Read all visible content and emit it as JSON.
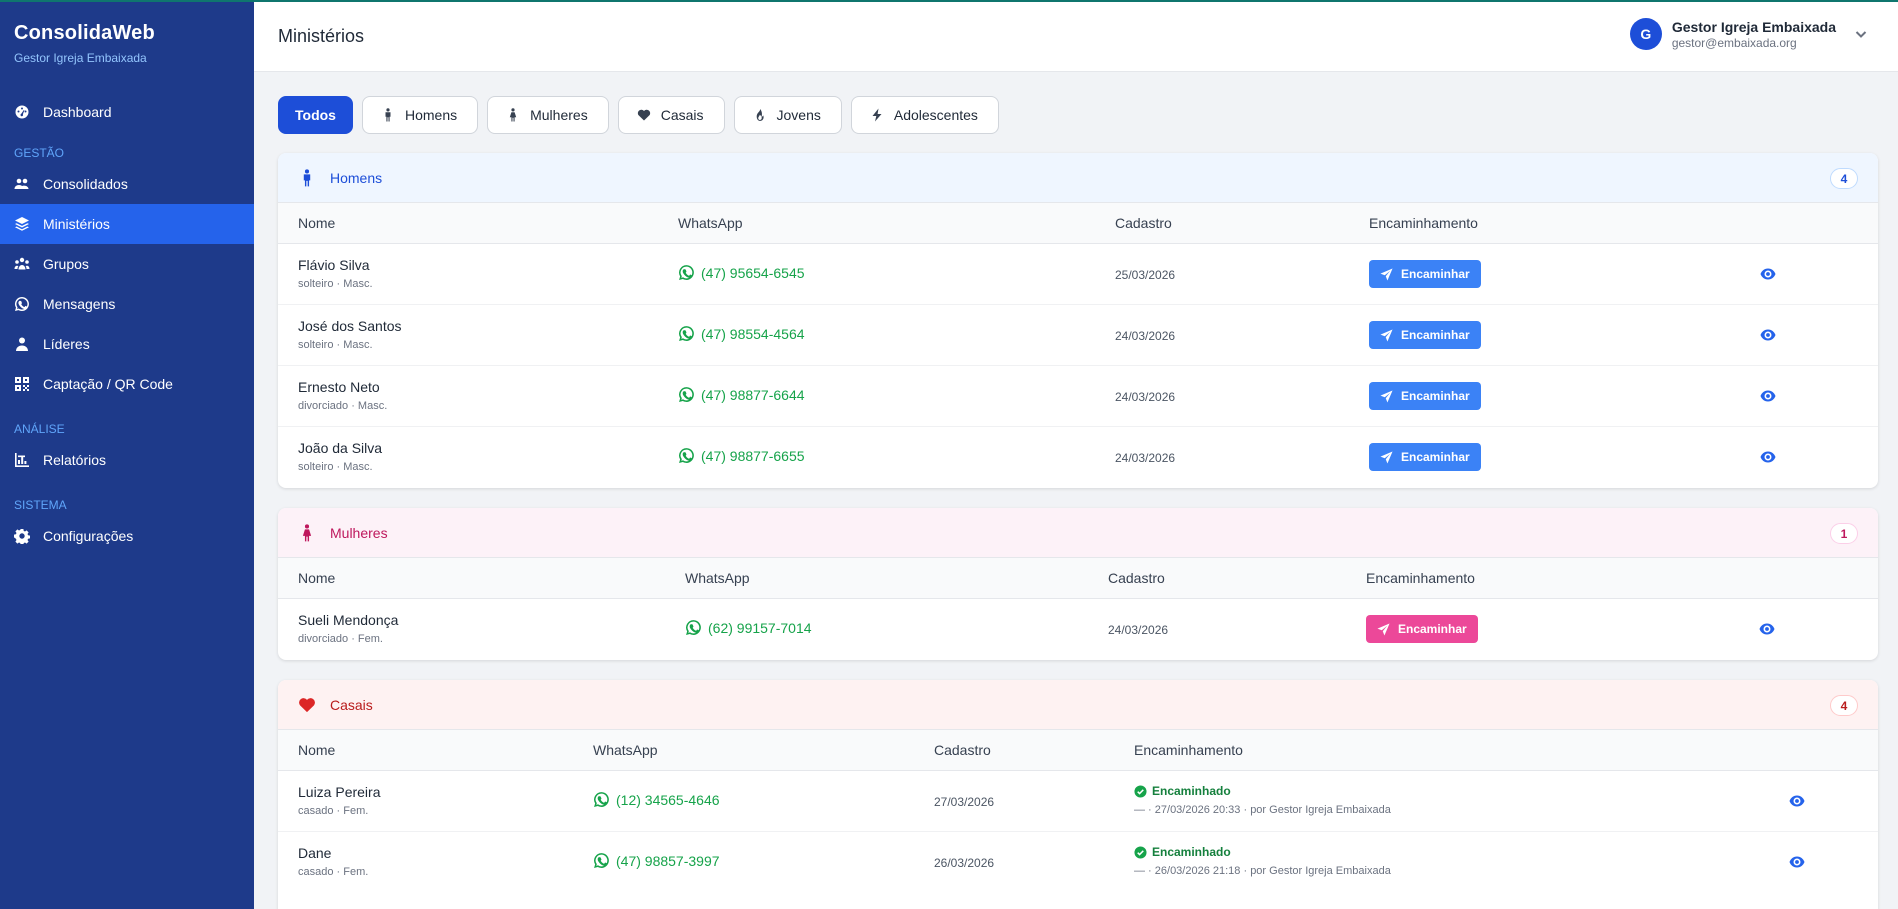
{
  "app": {
    "name": "ConsolidaWeb",
    "org": "Gestor Igreja Embaixada"
  },
  "sidebar": {
    "items": [
      {
        "label": "Dashboard",
        "icon": "gauge-icon"
      },
      {
        "section": "GESTÃO"
      },
      {
        "label": "Consolidados",
        "icon": "users-icon"
      },
      {
        "label": "Ministérios",
        "icon": "layers-icon",
        "active": true
      },
      {
        "label": "Grupos",
        "icon": "group-icon"
      },
      {
        "label": "Mensagens",
        "icon": "whatsapp-icon"
      },
      {
        "label": "Líderes",
        "icon": "user-icon"
      },
      {
        "label": "Captação / QR Code",
        "icon": "qrcode-icon"
      },
      {
        "section": "ANÁLISE"
      },
      {
        "label": "Relatórios",
        "icon": "chart-icon"
      },
      {
        "section": "SISTEMA"
      },
      {
        "label": "Configurações",
        "icon": "gear-icon"
      }
    ]
  },
  "header": {
    "title": "Ministérios",
    "user": {
      "initial": "G",
      "name": "Gestor Igreja Embaixada",
      "email": "gestor@embaixada.org"
    }
  },
  "filters": [
    {
      "label": "Todos",
      "active": true,
      "icon": ""
    },
    {
      "label": "Homens",
      "icon": "male-icon"
    },
    {
      "label": "Mulheres",
      "icon": "female-icon"
    },
    {
      "label": "Casais",
      "icon": "heart-icon"
    },
    {
      "label": "Jovens",
      "icon": "fire-icon"
    },
    {
      "label": "Adolescentes",
      "icon": "bolt-icon"
    }
  ],
  "columns": {
    "name": "Nome",
    "whatsapp": "WhatsApp",
    "date": "Cadastro",
    "forward": "Encaminhamento"
  },
  "homens": {
    "title": "Homens",
    "count": "4",
    "color": "#1d4ed8",
    "rows": [
      {
        "name": "Flávio Silva",
        "meta": "solteiro · Masc.",
        "phone": "(47) 95654-6545",
        "date": "25/03/2026",
        "action": "Encaminhar"
      },
      {
        "name": "José dos Santos",
        "meta": "solteiro · Masc.",
        "phone": "(47) 98554-4564",
        "date": "24/03/2026",
        "action": "Encaminhar"
      },
      {
        "name": "Ernesto Neto",
        "meta": "divorciado · Masc.",
        "phone": "(47) 98877-6644",
        "date": "24/03/2026",
        "action": "Encaminhar"
      },
      {
        "name": "João da Silva",
        "meta": "solteiro · Masc.",
        "phone": "(47) 98877-6655",
        "date": "24/03/2026",
        "action": "Encaminhar"
      }
    ]
  },
  "mulheres": {
    "title": "Mulheres",
    "count": "1",
    "color": "#be185d",
    "rows": [
      {
        "name": "Sueli Mendonça",
        "meta": "divorciado · Fem.",
        "phone": "(62) 99157-7014",
        "date": "24/03/2026",
        "action": "Encaminhar"
      }
    ]
  },
  "casais": {
    "title": "Casais",
    "count": "4",
    "color": "#b91c1c",
    "rows": [
      {
        "name": "Luiza Pereira",
        "meta": "casado · Fem.",
        "phone": "(12) 34565-4646",
        "date": "27/03/2026",
        "status": "Encaminhado",
        "detail": "— · 27/03/2026 20:33 · por Gestor Igreja Embaixada"
      },
      {
        "name": "Dane",
        "meta": "casado · Fem.",
        "phone": "(47) 98857-3997",
        "date": "26/03/2026",
        "status": "Encaminhado",
        "detail": "— · 26/03/2026 21:18 · por Gestor Igreja Embaixada"
      }
    ]
  }
}
